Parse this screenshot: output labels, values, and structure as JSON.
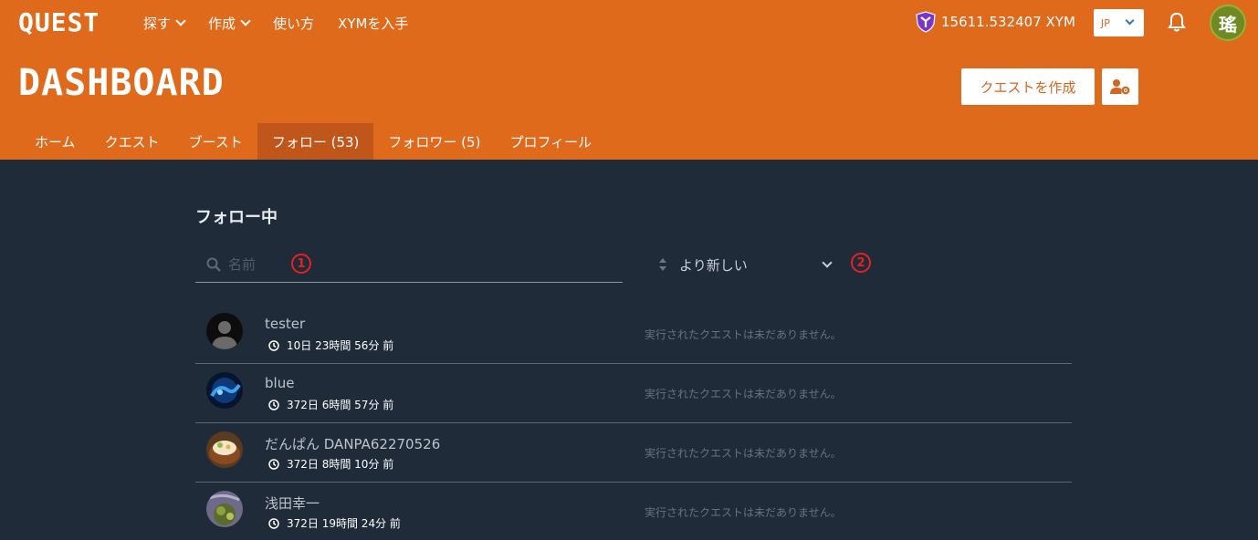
{
  "app": {
    "logo": "QUEST"
  },
  "topnav": [
    {
      "label": "探す",
      "dropdown": true
    },
    {
      "label": "作成",
      "dropdown": true
    },
    {
      "label": "使い方",
      "dropdown": false
    },
    {
      "label": "XYMを入手",
      "dropdown": false
    }
  ],
  "wallet": {
    "balance": "15611.532407 XYM",
    "icon": "symbol-shield-icon"
  },
  "language": {
    "selected": "JP"
  },
  "user": {
    "avatar_text": "瑤"
  },
  "page": {
    "title": "DASHBOARD",
    "create_label": "クエストを作成"
  },
  "tabs": [
    {
      "label": "ホーム",
      "active": false
    },
    {
      "label": "クエスト",
      "active": false
    },
    {
      "label": "ブースト",
      "active": false
    },
    {
      "label": "フォロー (53)",
      "active": true
    },
    {
      "label": "フォロワー (5)",
      "active": false
    },
    {
      "label": "プロフィール",
      "active": false
    }
  ],
  "following": {
    "title": "フォロー中",
    "search_placeholder": "名前",
    "marker1": "1",
    "marker2": "2",
    "sort_label": "より新しい",
    "items": [
      {
        "name": "tester",
        "time": "10日 23時間 56分 前",
        "status": "実行されたクエストは未だありません。",
        "avatar": "default"
      },
      {
        "name": "blue",
        "time": "372日 6時間 57分 前",
        "status": "実行されたクエストは未だありません。",
        "avatar": "blue"
      },
      {
        "name": "だんぱん DANPA62270526",
        "time": "372日 8時間 10分 前",
        "status": "実行されたクエストは未だありません。",
        "avatar": "food"
      },
      {
        "name": "浅田幸一",
        "time": "372日 19時間 24分 前",
        "status": "実行されたクエストは未だありません。",
        "avatar": "plant"
      }
    ]
  },
  "colors": {
    "header": "#df6a1c",
    "active_tab": "#c0561a",
    "body_bg": "#1f2b38",
    "marker": "#e52222"
  }
}
